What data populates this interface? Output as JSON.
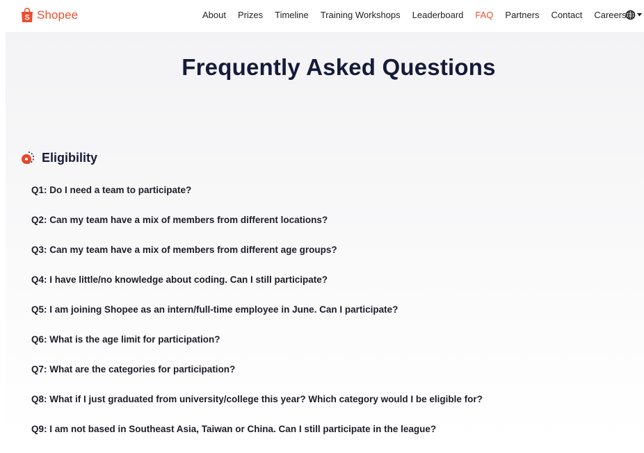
{
  "brand": {
    "name": "Shopee",
    "color": "#ee4d2d"
  },
  "nav": {
    "items": [
      "About",
      "Prizes",
      "Timeline",
      "Training Workshops",
      "Leaderboard",
      "FAQ",
      "Partners",
      "Contact",
      "Careers"
    ],
    "active": "FAQ",
    "language_icon": "globe-icon"
  },
  "page": {
    "title": "Frequently Asked Questions"
  },
  "section": {
    "title": "Eligibility",
    "icon": "eligibility-icon",
    "questions": [
      "Q1: Do I need a team to participate?",
      "Q2: Can my team have a mix of members from different locations?",
      "Q3: Can my team have a mix of members from different age groups?",
      "Q4: I have little/no knowledge about coding. Can I still participate?",
      "Q5: I am joining Shopee as an intern/full-time employee in June. Can I participate?",
      "Q6: What is the age limit for participation?",
      "Q7: What are the categories for participation?",
      "Q8: What if I just graduated from university/college this year? Which category would I be eligible for?",
      "Q9: I am not based in Southeast Asia, Taiwan or China. Can I still participate in the league?"
    ]
  }
}
